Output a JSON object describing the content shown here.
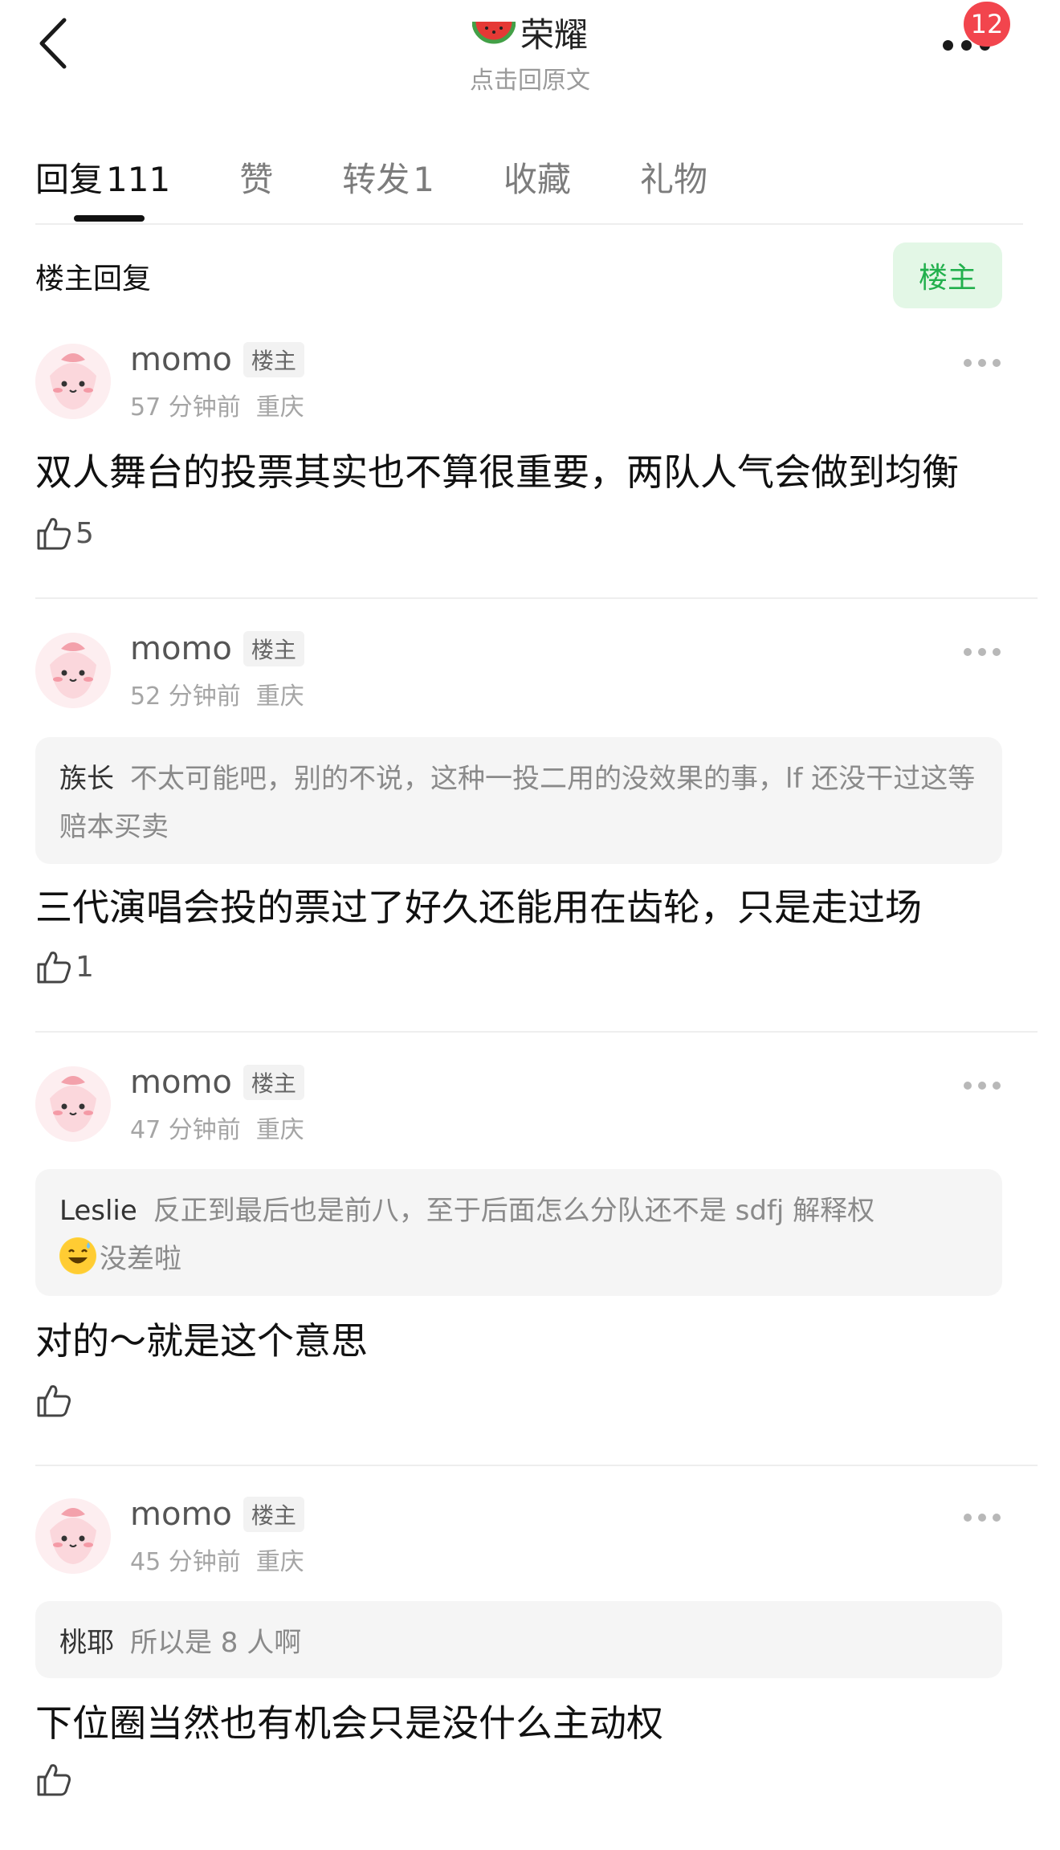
{
  "header": {
    "title": "荣耀",
    "subtitle": "点击回原文",
    "notification_count": "12",
    "title_icon": "watermelon-icon"
  },
  "tabs": [
    {
      "label": "回复",
      "count": "111",
      "active": true
    },
    {
      "label": "赞",
      "count": "",
      "active": false
    },
    {
      "label": "转发",
      "count": "1",
      "active": false
    },
    {
      "label": "收藏",
      "count": "",
      "active": false
    },
    {
      "label": "礼物",
      "count": "",
      "active": false
    }
  ],
  "section": {
    "title": "楼主回复",
    "filter_label": "楼主"
  },
  "comments": [
    {
      "user": "momo",
      "tag": "楼主",
      "time": "57 分钟前",
      "location": "重庆",
      "quote_user": "",
      "quote_text": "",
      "text": "双人舞台的投票其实也不算很重要，两队人气会做到均衡",
      "likes": "5"
    },
    {
      "user": "momo",
      "tag": "楼主",
      "time": "52 分钟前",
      "location": "重庆",
      "quote_user": "族长",
      "quote_text": "不太可能吧，别的不说，这种一投二用的没效果的事，lf 还没干过这等赔本买卖",
      "text": "三代演唱会投的票过了好久还能用在齿轮，只是走过场",
      "likes": "1"
    },
    {
      "user": "momo",
      "tag": "楼主",
      "time": "47 分钟前",
      "location": "重庆",
      "quote_user": "Leslie",
      "quote_text": "反正到最后也是前八，至于后面怎么分队还不是 sdfj 解释权",
      "quote_tail": "没差啦",
      "text": "对的～就是这个意思",
      "likes": ""
    },
    {
      "user": "momo",
      "tag": "楼主",
      "time": "45 分钟前",
      "location": "重庆",
      "quote_user": "桃耶",
      "quote_text": "所以是 8 人啊",
      "text": "下位圈当然也有机会只是没什么主动权",
      "likes": ""
    }
  ]
}
